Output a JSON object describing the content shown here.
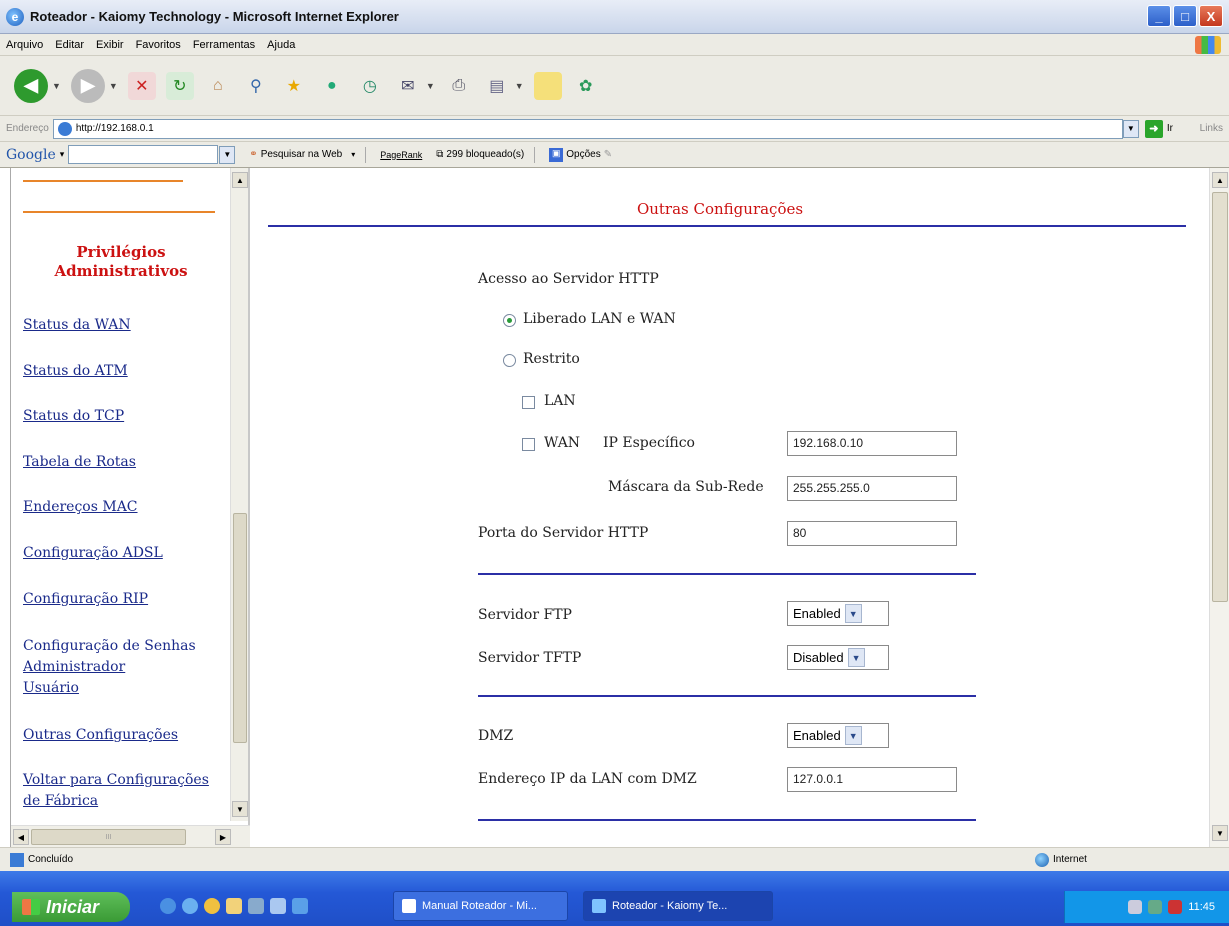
{
  "window": {
    "title": "Roteador - Kaiomy Technology - Microsoft Internet Explorer",
    "controls": {
      "minimize": "_",
      "maximize": "□",
      "close": "X"
    }
  },
  "menu": [
    "Arquivo",
    "Editar",
    "Exibir",
    "Favoritos",
    "Ferramentas",
    "Ajuda"
  ],
  "toolbar": {
    "icons": [
      "back-icon",
      "forward-icon",
      "stop-icon",
      "refresh-icon",
      "home-icon",
      "search-icon",
      "favorites-icon",
      "media-icon",
      "history-icon",
      "mail-icon",
      "print-icon",
      "edit-icon",
      "discuss-icon",
      "messenger-icon"
    ]
  },
  "address": {
    "label": "Endereço",
    "url": "http://192.168.0.1",
    "go_label": "Ir",
    "links_label": "Links"
  },
  "googlebar": {
    "logo": "Google",
    "search_value": "",
    "search_web": "Pesquisar na Web",
    "pagerank": "PageRank",
    "blocked": "299 bloqueado(s)",
    "options": "Opções"
  },
  "sidebar": {
    "section_title": "Privilégios Administrativos",
    "links": [
      "Status da WAN",
      "Status do ATM",
      "Status do TCP",
      "Tabela de Rotas",
      "Endereços MAC",
      "Configuração ADSL",
      "Configuração RIP"
    ],
    "passwords_title": "Configuração de Senhas",
    "passwords_admin": "Administrador",
    "passwords_user": "Usuário",
    "other": "Outras Configurações",
    "factory_line1": "Voltar para Configurações",
    "factory_line2": "de Fábrica",
    "scroll_marker": "III"
  },
  "main": {
    "title": "Outras Configurações",
    "http_access_label": "Acesso ao Servidor HTTP",
    "opt_lan_wan": "Liberado LAN e WAN",
    "opt_restricted": "Restrito",
    "chk_lan": "LAN",
    "chk_wan": "WAN",
    "ip_specific_label": "IP Específico",
    "ip_specific_value": "192.168.0.10",
    "subnet_label": "Máscara da Sub-Rede",
    "subnet_value": "255.255.255.0",
    "http_port_label": "Porta do Servidor HTTP",
    "http_port_value": "80",
    "ftp_label": "Servidor FTP",
    "ftp_value": "Enabled",
    "tftp_label": "Servidor TFTP",
    "tftp_value": "Disabled",
    "dmz_label": "DMZ",
    "dmz_value": "Enabled",
    "dmz_ip_label": "Endereço IP da LAN com DMZ",
    "dmz_ip_value": "127.0.0.1",
    "selected_access": "Liberado LAN e WAN"
  },
  "status": {
    "text": "Concluído",
    "zone": "Internet"
  },
  "taskbar": {
    "start": "Iniciar",
    "tasks": [
      "Manual Roteador - Mi...",
      "Roteador - Kaiomy Te..."
    ],
    "clock": "11:45"
  },
  "colors": {
    "accent_red": "#cc1111",
    "rule_blue": "#2b2fa6",
    "rule_orange": "#e8852a",
    "link": "#1a2a8a",
    "taskbar": "#2458d6"
  }
}
